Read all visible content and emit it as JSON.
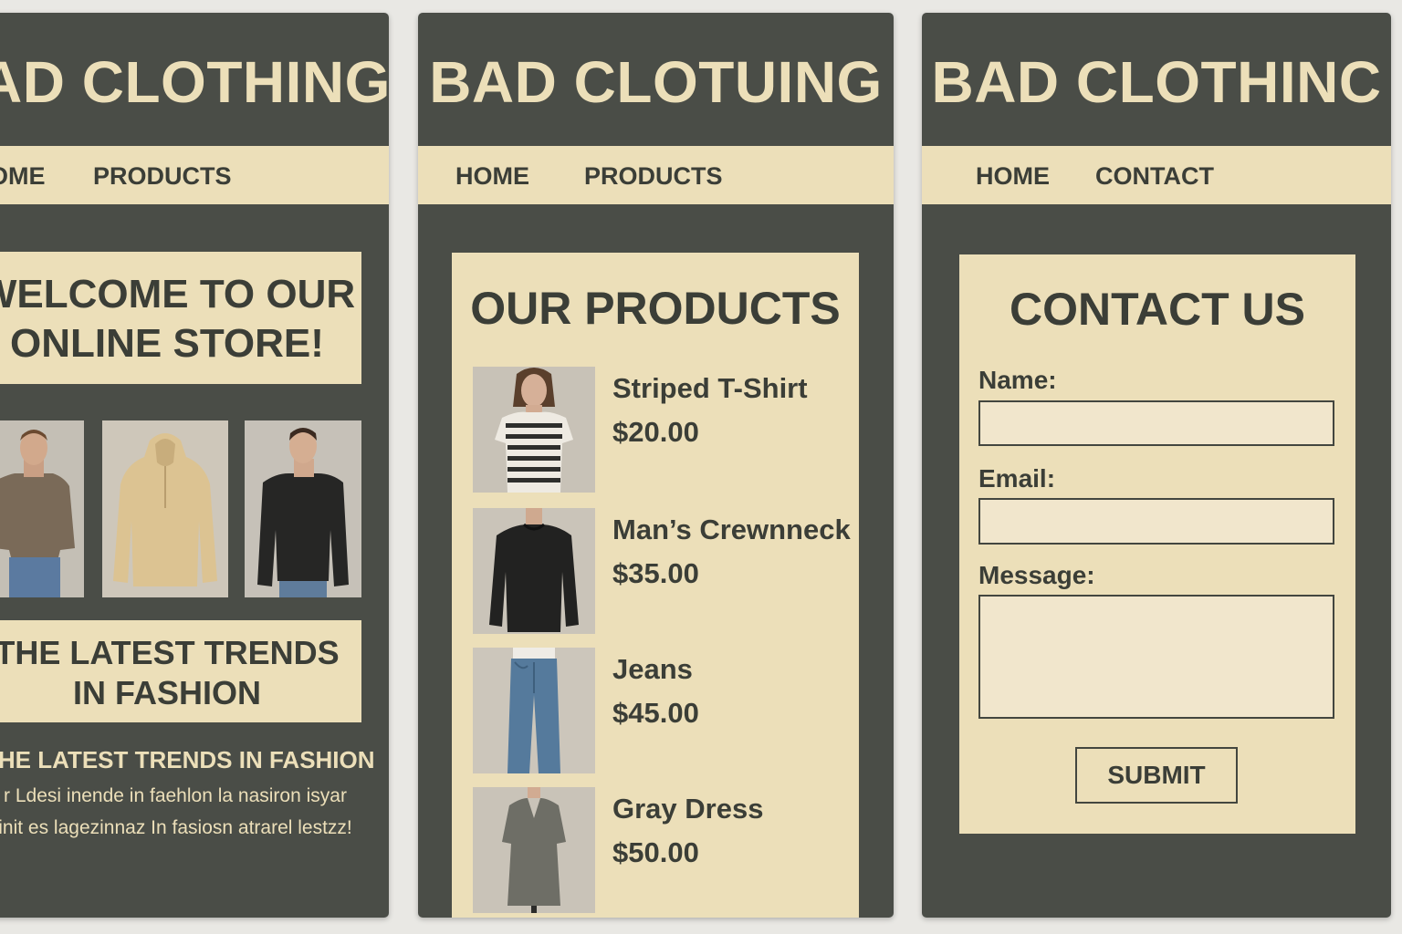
{
  "colors": {
    "panel_background": "#4a4d47",
    "accent_cream": "#ecdfb9",
    "text_dark": "#3b3e37",
    "page_background": "#e9e8e4"
  },
  "home": {
    "brand": "AD CLOTHING",
    "nav": [
      "OME",
      "PRODUCTS"
    ],
    "welcome_line1": "WELCOME TO OUR",
    "welcome_line2": "ONLINE STORE!",
    "images": [
      {
        "icon": "man-brown-tshirt-photo"
      },
      {
        "icon": "beige-hoodie-photo"
      },
      {
        "icon": "man-black-sweater-photo"
      }
    ],
    "trend_box_line1": "THE LATEST TRENDS",
    "trend_box_line2": "IN FASHION",
    "trend_heading": "THE LATEST TRENDS IN FASHION",
    "body_line1": "r Ldesi inende in faehlon la nasiron isyar",
    "body_line2": "init es lagezinnaz In fasiosn atrarel lestzz!"
  },
  "products": {
    "brand": "BAD CLOTUING",
    "nav": [
      "HOME",
      "PRODUCTS"
    ],
    "title": "OUR PRODUCTS",
    "items": [
      {
        "name": "Striped  T-Shirt",
        "price": "$20.00",
        "icon": "striped-tshirt-photo"
      },
      {
        "name": "Man’s Crewnneck",
        "price": "$35.00",
        "icon": "crewneck-photo"
      },
      {
        "name": "Jeans",
        "price": "$45.00",
        "icon": "jeans-photo"
      },
      {
        "name": "Gray Dress",
        "price": "$50.00",
        "icon": "gray-dress-photo"
      }
    ]
  },
  "contact": {
    "brand": "BAD CLOTHINC",
    "nav": [
      "HOME",
      "CONTACT"
    ],
    "title": "CONTACT US",
    "name_label": "Name:",
    "email_label": "Email:",
    "message_label": "Message:",
    "name_value": "",
    "email_value": "",
    "message_value": "",
    "submit_label": "SUBMIT"
  }
}
